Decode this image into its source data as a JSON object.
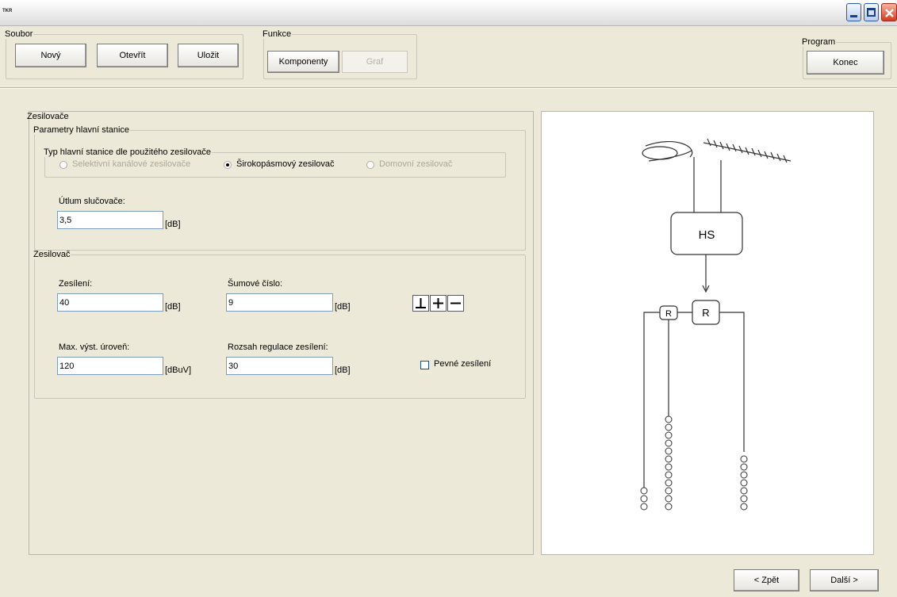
{
  "window": {
    "title": "TKR"
  },
  "soubor": {
    "legend": "Soubor",
    "new_label": "Nový",
    "open_label": "Otevřít",
    "save_label": "Uložit"
  },
  "funkce": {
    "legend": "Funkce",
    "components_label": "Komponenty",
    "graph_label": "Graf"
  },
  "program": {
    "legend": "Program",
    "end_label": "Konec"
  },
  "zesilovace": {
    "legend": "Zesilovače",
    "params": {
      "legend": "Parametry hlavní stanice",
      "type_group": {
        "legend": "Typ hlavní stanice dle použitého zesilovače",
        "options": [
          {
            "label": "Selektivní kanálové zesilovače",
            "enabled": false,
            "selected": false
          },
          {
            "label": "Širokopásmový zesilovač",
            "enabled": true,
            "selected": true
          },
          {
            "label": "Domovní zesilovač",
            "enabled": false,
            "selected": false
          }
        ]
      },
      "utlum": {
        "label": "Útlum slučovače:",
        "value": "3,5",
        "unit": "[dB]"
      }
    },
    "amp": {
      "legend": "Zesilovač",
      "gain": {
        "label": "Zesílení:",
        "value": "40",
        "unit": "[dB]"
      },
      "noise": {
        "label": "Šumové číslo:",
        "value": "9",
        "unit": "[dB]"
      },
      "max_out": {
        "label": "Max. výst. úroveň:",
        "value": "120",
        "unit": "[dBuV]"
      },
      "range": {
        "label": "Rozsah regulace zesílení:",
        "value": "30",
        "unit": "[dB]"
      },
      "fixed_gain": {
        "label": "Pevné zesílení",
        "checked": false
      },
      "tool_buttons": [
        "ground-icon",
        "plus-icon",
        "minus-icon"
      ]
    }
  },
  "diagram": {
    "hs_label": "HS",
    "r_label": "R",
    "r_small_label": "R"
  },
  "nav": {
    "back_label": "< Zpět",
    "next_label": "Další >"
  }
}
